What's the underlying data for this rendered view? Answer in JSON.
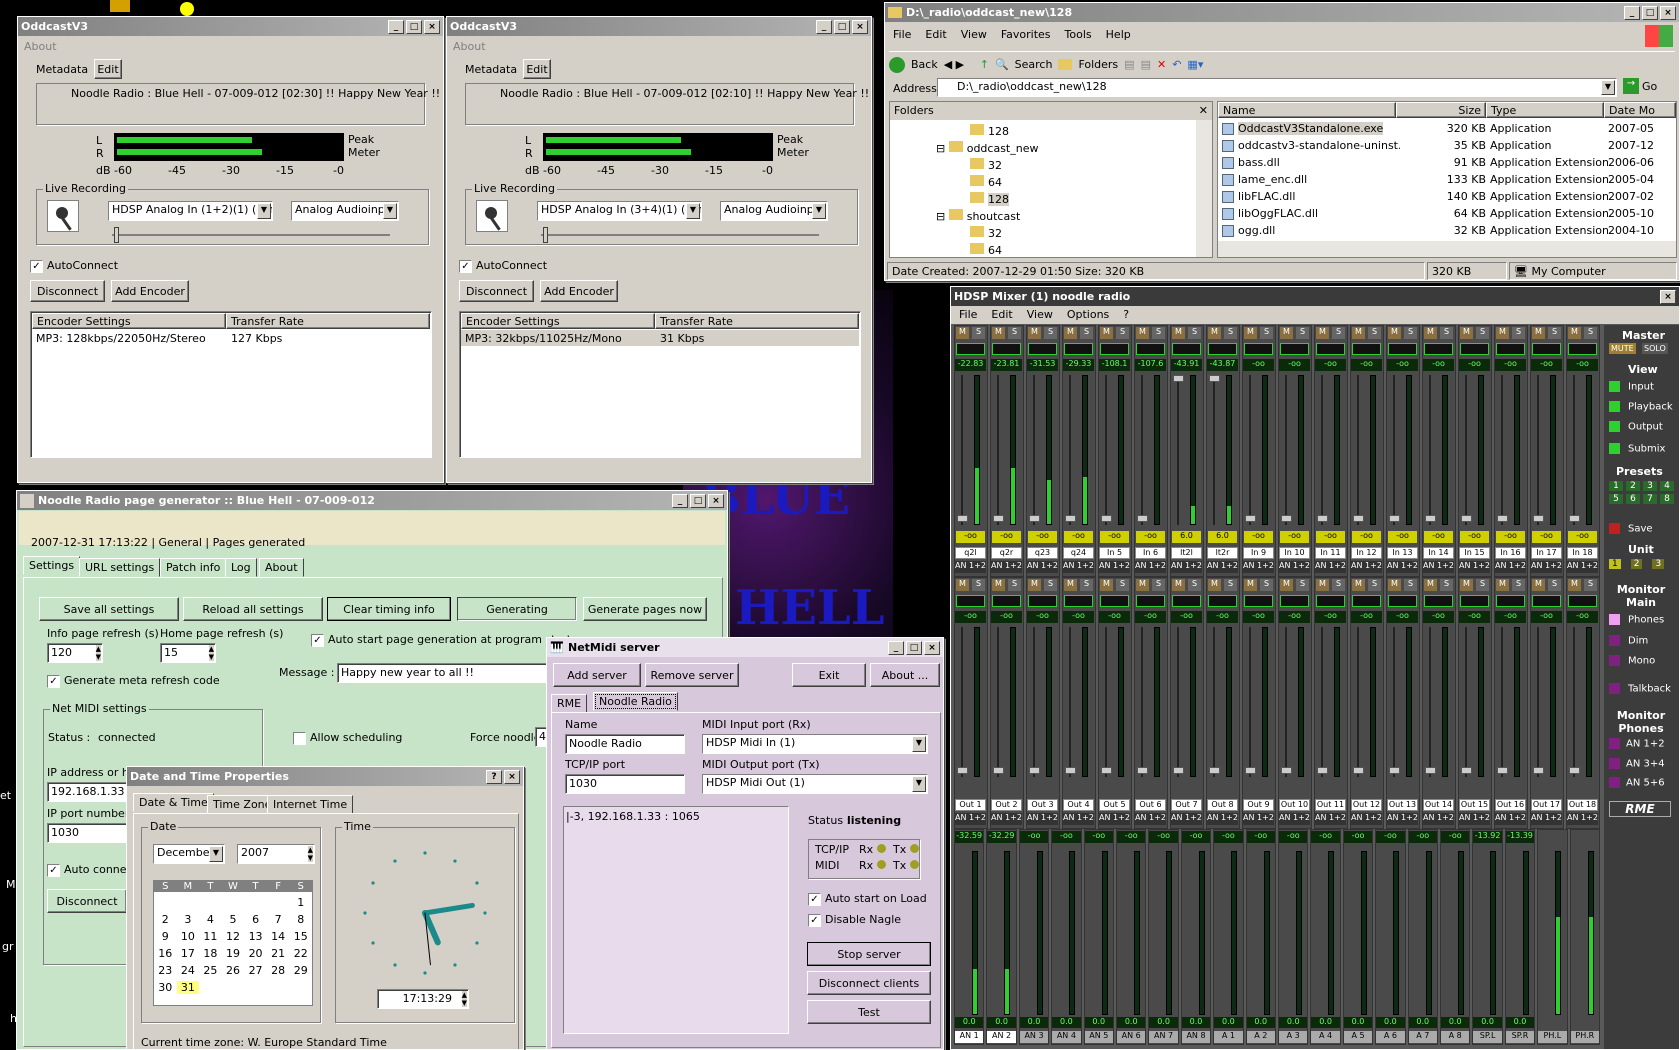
{
  "desktop": {
    "bg_text_1": "BLUE",
    "bg_text_2": "HELL"
  },
  "oddcast1": {
    "title": "OddcastV3",
    "menu": "About",
    "metadata_label": "Metadata",
    "edit_btn": "Edit",
    "now_playing": "Noodle Radio : Blue Hell - 07-009-012 [02:30] !! Happy New Year !!",
    "L": "L",
    "R": "R",
    "peak": "Peak",
    "meter": "Meter",
    "scale": [
      "dB -60",
      "-45",
      "-30",
      "-15",
      "-0"
    ],
    "live_recording": "Live Recording",
    "input": "HDSP Analog In (1+2)(1) (emul",
    "input2": "Analog Audioinput",
    "autoconnect": "AutoConnect",
    "disconnect": "Disconnect",
    "add_encoder": "Add Encoder",
    "col1": "Encoder Settings",
    "col2": "Transfer Rate",
    "row_enc": "MP3: 128kbps/22050Hz/Stereo",
    "row_rate": "127 Kbps"
  },
  "oddcast2": {
    "title": "OddcastV3",
    "menu": "About",
    "metadata_label": "Metadata",
    "edit_btn": "Edit",
    "now_playing": "Noodle Radio : Blue Hell - 07-009-012 [02:10] !! Happy New Year !!",
    "L": "L",
    "R": "R",
    "peak": "Peak",
    "meter": "Meter",
    "scale": [
      "dB -60",
      "-45",
      "-30",
      "-15",
      "-0"
    ],
    "live_recording": "Live Recording",
    "input": "HDSP Analog In (3+4)(1) (emul",
    "input2": "Analog Audioinput",
    "autoconnect": "AutoConnect",
    "disconnect": "Disconnect",
    "add_encoder": "Add Encoder",
    "col1": "Encoder Settings",
    "col2": "Transfer Rate",
    "row_enc": "MP3: 32kbps/11025Hz/Mono",
    "row_rate": "31 Kbps"
  },
  "explorer": {
    "title": "D:\\_radio\\oddcast_new\\128",
    "menu": [
      "File",
      "Edit",
      "View",
      "Favorites",
      "Tools",
      "Help"
    ],
    "back": "Back",
    "search": "Search",
    "folders": "Folders",
    "address_label": "Address",
    "address": "D:\\_radio\\oddcast_new\\128",
    "go": "Go",
    "folders_pane": "Folders",
    "tree": [
      "128",
      "oddcast_new",
      "32",
      "64",
      "128",
      "shoutcast",
      "32",
      "64"
    ],
    "cols": [
      "Name",
      "Size",
      "Type",
      "Date Mo"
    ],
    "files": [
      {
        "name": "OddcastV3Standalone.exe",
        "size": "320 KB",
        "type": "Application",
        "date": "2007-05"
      },
      {
        "name": "oddcastv3-standalone-uninst....",
        "size": "35 KB",
        "type": "Application",
        "date": "2007-12"
      },
      {
        "name": "bass.dll",
        "size": "91 KB",
        "type": "Application Extension",
        "date": "2006-06"
      },
      {
        "name": "lame_enc.dll",
        "size": "133 KB",
        "type": "Application Extension",
        "date": "2005-04"
      },
      {
        "name": "libFLAC.dll",
        "size": "140 KB",
        "type": "Application Extension",
        "date": "2007-02"
      },
      {
        "name": "libOggFLAC.dll",
        "size": "64 KB",
        "type": "Application Extension",
        "date": "2005-10"
      },
      {
        "name": "ogg.dll",
        "size": "32 KB",
        "type": "Application Extension",
        "date": "2004-10"
      }
    ],
    "status1": "Date Created: 2007-12-29 01:50 Size: 320 KB",
    "status2": "320 KB",
    "status3": "My Computer"
  },
  "mixer": {
    "title": "HDSP Mixer (1) noodle radio",
    "menu": [
      "File",
      "Edit",
      "View",
      "Options",
      "?"
    ],
    "row1_levels": [
      "-22.83",
      "-23.81",
      "-31.53",
      "-29.33",
      "-108.1",
      "-107.6",
      "-43.91",
      "-43.87",
      "-oo",
      "-oo",
      "-oo",
      "-oo",
      "-oo",
      "-oo",
      "-oo",
      "-oo",
      "-oo",
      "-oo"
    ],
    "row1_fader": [
      "-oo",
      "-oo",
      "-oo",
      "-oo",
      "-oo",
      "-oo",
      "6.0",
      "6.0",
      "-oo",
      "-oo",
      "-oo",
      "-oo",
      "-oo",
      "-oo",
      "-oo",
      "-oo",
      "-oo",
      "-oo"
    ],
    "row1_names": [
      "q2l",
      "q2r",
      "q23",
      "q24",
      "In 5",
      "In 6",
      "lt2l",
      "lt2r",
      "In 9",
      "In 10",
      "In 11",
      "In 12",
      "In 13",
      "In 14",
      "In 15",
      "In 16",
      "In 17",
      "In 18"
    ],
    "row1_meter": [
      0.38,
      0.38,
      0.3,
      0.32,
      0,
      0,
      0.12,
      0.12,
      0,
      0,
      0,
      0,
      0,
      0,
      0,
      0,
      0,
      0
    ],
    "row2_names": [
      "Out 1",
      "Out 2",
      "Out 3",
      "Out 4",
      "Out 5",
      "Out 6",
      "Out 7",
      "Out 8",
      "Out 9",
      "Out 10",
      "Out 11",
      "Out 12",
      "Out 13",
      "Out 14",
      "Out 15",
      "Out 16",
      "Out 17",
      "Out 18"
    ],
    "row3_levels": [
      "-32.59",
      "-32.29",
      "-oo",
      "-oo",
      "-oo",
      "-oo",
      "-oo",
      "-oo",
      "-oo",
      "-oo",
      "-oo",
      "-oo",
      "-oo",
      "-oo",
      "-oo",
      "-oo",
      "-13.92",
      "-13.39"
    ],
    "row3_vals": [
      "0.0",
      "0.0",
      "0.0",
      "0.0",
      "0.0",
      "0.0",
      "0.0",
      "0.0",
      "0.0",
      "0.0",
      "0.0",
      "0.0",
      "0.0",
      "0.0",
      "0.0",
      "0.0",
      "0.0",
      "0.0"
    ],
    "row3_names": [
      "AN 1",
      "AN 2",
      "AN 3",
      "AN 4",
      "AN 5",
      "AN 6",
      "AN 7",
      "AN 8",
      "A 1",
      "A 2",
      "A 3",
      "A 4",
      "A 5",
      "A 6",
      "A 7",
      "A 8",
      "SP.L",
      "SP.R",
      "PH.L",
      "PH.R"
    ],
    "row3_meter": [
      0.28,
      0.28,
      0,
      0,
      0,
      0,
      0,
      0,
      0,
      0,
      0,
      0,
      0,
      0,
      0,
      0,
      0,
      0,
      0.6,
      0.6
    ],
    "route": "AN 1+2",
    "m": "M",
    "s": "S",
    "neg": "-oo",
    "master": "Master",
    "mute": "MUTE",
    "solo": "SOLO",
    "view": "View",
    "view_items": [
      "Input",
      "Playback",
      "Output",
      "Submix"
    ],
    "presets": "Presets",
    "preset_nums": [
      "1",
      "2",
      "3",
      "4",
      "5",
      "6",
      "7",
      "8"
    ],
    "save": "Save",
    "unit": "Unit",
    "unit_nums": [
      "1",
      "2",
      "3"
    ],
    "monitor_main": "Monitor Main",
    "mm_items": [
      "Phones",
      "Dim",
      "Mono",
      "Talkback"
    ],
    "monitor_phones": "Monitor Phones",
    "mp_items": [
      "AN 1+2",
      "AN 3+4",
      "AN 5+6"
    ],
    "logo": "RME"
  },
  "pagegen": {
    "title": "Noodle Radio  page generator :: Blue Hell - 07-009-012",
    "status": "2007-12-31 17:13:22 | General    | Pages generated",
    "tabs": [
      "Settings",
      "URL settings",
      "Patch info",
      "Log",
      "About"
    ],
    "btns": [
      "Save all settings",
      "Reload all settings",
      "Clear timing info",
      "Generating",
      "Generate pages now"
    ],
    "info_refresh": "Info page refresh (s)",
    "info_val": "120",
    "home_refresh": "Home page refresh (s)",
    "home_val": "15",
    "auto_start": "Auto start page generation at program startup",
    "meta_refresh": "Generate meta refresh code",
    "message_label": "Message :",
    "message_val": "Happy new year to all !!",
    "netmidi": "Net MIDI settings",
    "status_lbl": "Status :",
    "status_val": "connected",
    "allow_sched": "Allow scheduling",
    "force": "Force noodle",
    "force_val": "4",
    "ip_label": "IP address or ho",
    "ip_val": "192.168.1.33",
    "port_label": "IP port number (",
    "port_val": "1030",
    "auto_conn": "Auto connec",
    "disconnect": "Disconnect",
    "side_chars": [
      "et",
      "M",
      "gr",
      "h"
    ]
  },
  "datetime": {
    "title": "Date and Time Properties",
    "tabs": [
      "Date & Time",
      "Time Zone",
      "Internet Time"
    ],
    "date": "Date",
    "month": "December",
    "year": "2007",
    "days": [
      "S",
      "M",
      "T",
      "W",
      "T",
      "F",
      "S"
    ],
    "cal": [
      [
        "",
        "",
        "",
        "",
        "",
        "",
        "1"
      ],
      [
        "2",
        "3",
        "4",
        "5",
        "6",
        "7",
        "8"
      ],
      [
        "9",
        "10",
        "11",
        "12",
        "13",
        "14",
        "15"
      ],
      [
        "16",
        "17",
        "18",
        "19",
        "20",
        "21",
        "22"
      ],
      [
        "23",
        "24",
        "25",
        "26",
        "27",
        "28",
        "29"
      ],
      [
        "30",
        "31",
        "",
        "",
        "",
        "",
        ""
      ]
    ],
    "time": "Time",
    "time_val": "17:13:29",
    "tz_prefix": "Current time zone:",
    "tz": "W. Europe Standard Time"
  },
  "netmidi": {
    "title": "NetMidi server",
    "add": "Add server",
    "remove": "Remove server",
    "exit": "Exit",
    "about": "About ...",
    "tabs": [
      "RME",
      "Noodle Radio"
    ],
    "name_lbl": "Name",
    "name_val": "Noodle Radio",
    "midi_in_lbl": "MIDI Input port (Rx)",
    "midi_in": "HDSP Midi In (1)",
    "port_lbl": "TCP/IP port",
    "port_val": "1030",
    "midi_out_lbl": "MIDI Output port (Tx)",
    "midi_out": "HDSP Midi Out (1)",
    "client": "|-3, 192.168.1.33 : 1065",
    "status_lbl": "Status :",
    "status_val": "listening",
    "tcpip": "TCP/IP",
    "midi": "MIDI",
    "rx": "Rx",
    "tx": "Tx",
    "auto_start": "Auto start on Load",
    "nagle": "Disable Nagle",
    "stop": "Stop server",
    "disc": "Disconnect clients",
    "test": "Test"
  }
}
